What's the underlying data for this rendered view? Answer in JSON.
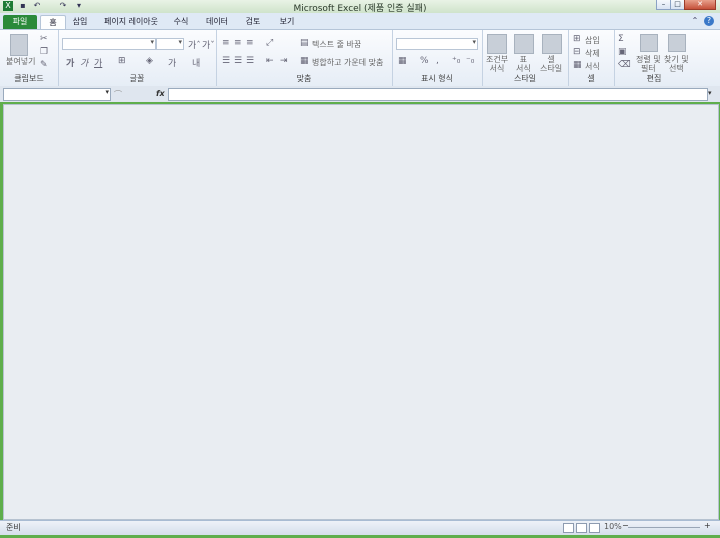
{
  "window": {
    "title": "Microsoft Excel (제품 인증 실패)",
    "buttons": {
      "minimize": "–",
      "restore": "□",
      "close": "✕"
    }
  },
  "tabs": [
    "파일",
    "홈",
    "삽입",
    "페이지 레이아웃",
    "수식",
    "데이터",
    "검토",
    "보기"
  ],
  "ribbon": {
    "clipboard": {
      "label": "클립보드",
      "paste": "붙여넣기"
    },
    "font": {
      "label": "글꼴"
    },
    "alignment": {
      "label": "맞춤",
      "wrap_text": "텍스트 줄 바꿈",
      "merge_center": "병합하고 가운데 맞춤"
    },
    "number": {
      "label": "표시 형식",
      "percent": "%",
      "comma": ","
    },
    "styles": {
      "label": "스타일",
      "conditional_format": [
        "조건부",
        "서식"
      ],
      "format_table": [
        "표",
        "서식"
      ],
      "cell_styles": [
        "셀",
        "스타일"
      ]
    },
    "cells": {
      "label": "셀",
      "insert": "삽입",
      "delete": "삭제",
      "format": "서식"
    },
    "editing": {
      "label": "편집",
      "sort_filter": [
        "정렬 및",
        "필터"
      ],
      "find_select": [
        "찾기 및",
        "선택"
      ]
    }
  },
  "formula_bar": {
    "fx": "fx"
  },
  "status": {
    "ready": "준비",
    "zoom": "10%"
  }
}
